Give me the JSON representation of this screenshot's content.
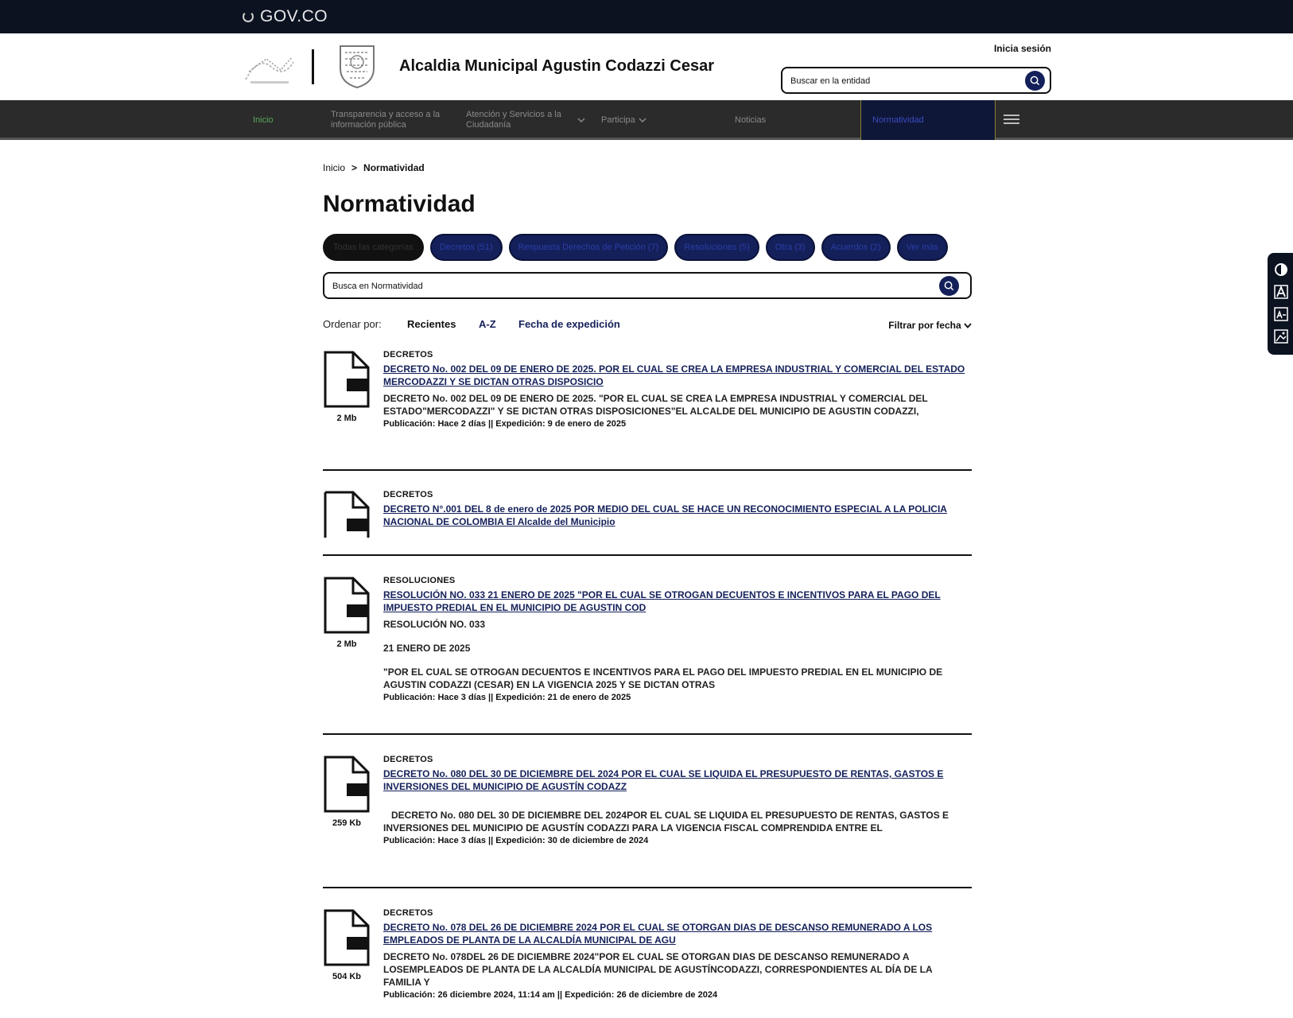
{
  "govbar": {
    "logo_text": "GOV.CO"
  },
  "header": {
    "site_title": "Alcaldia Municipal Agustin Codazzi Cesar",
    "login_label": "Inicia sesión",
    "search_placeholder": "Buscar en la entidad"
  },
  "nav": {
    "items": [
      {
        "label": "Inicio"
      },
      {
        "label": "Transparencia y acceso a la información pública"
      },
      {
        "label": "Atención y Servicios a la Ciudadanía"
      },
      {
        "label": "Participa"
      },
      {
        "label": "Noticias"
      },
      {
        "label": "Normatividad"
      }
    ]
  },
  "breadcrumb": {
    "home": "Inicio",
    "separator": ">",
    "current": "Normatividad"
  },
  "page": {
    "title": "Normatividad"
  },
  "chips": [
    {
      "label": "Todas las categorías"
    },
    {
      "label": "Decretos (51)"
    },
    {
      "label": "Respuesta Derechos de Petición (7)"
    },
    {
      "label": "Resoluciones (5)"
    },
    {
      "label": "Otra (3)"
    },
    {
      "label": "Acuerdos (2)"
    },
    {
      "label": "Ver más"
    }
  ],
  "norm_search": {
    "placeholder": "Busca en Normatividad"
  },
  "sort": {
    "label": "Ordenar por:",
    "recent": "Recientes",
    "az": "A-Z",
    "date": "Fecha de expedición",
    "filter": "Filtrar por fecha"
  },
  "results": [
    {
      "category": "DECRETOS",
      "title": "DECRETO No. 002 DEL 09 DE ENERO DE 2025. POR EL CUAL SE CREA LA EMPRESA INDUSTRIAL Y COMERCIAL DEL ESTADO MERCODAZZI Y SE DICTAN OTRAS DISPOSICIO",
      "description": [
        "DECRETO No. 002 DEL 09 DE ENERO DE 2025. \"POR EL CUAL SE CREA LA EMPRESA INDUSTRIAL Y COMERCIAL DEL ESTADO\"MERCODAZZI\" Y SE DICTAN OTRAS DISPOSICIONES\"EL ALCALDE DEL MUNICIPIO DE AGUSTIN CODAZZI,"
      ],
      "meta": "Publicación: Hace 2 días || Expedición: 9 de enero de 2025",
      "size": "2 Mb"
    },
    {
      "category": "DECRETOS",
      "title": "DECRETO N°.001 DEL 8 de enero de 2025 POR MEDIO DEL CUAL SE HACE UN RECONOCIMIENTO ESPECIAL A LA POLICIA NACIONAL DE COLOMBIA El Alcalde del Municipio",
      "description": [],
      "meta": "",
      "size": ""
    },
    {
      "category": "RESOLUCIONES",
      "title": "RESOLUCIÓN NO. 033 21 ENERO DE 2025 \"POR EL CUAL SE OTROGAN DECUENTOS E INCENTIVOS PARA EL PAGO DEL IMPUESTO PREDIAL EN EL MUNICIPIO DE AGUSTIN COD",
      "description": [
        "RESOLUCIÓN NO. 033",
        "21 ENERO DE 2025",
        "\"POR EL CUAL SE OTROGAN DECUENTOS E INCENTIVOS PARA EL PAGO DEL IMPUESTO PREDIAL EN EL MUNICIPIO DE AGUSTIN CODAZZI (CESAR) EN LA VIGENCIA 2025 Y SE DICTAN OTRAS"
      ],
      "meta": "Publicación: Hace 3 días || Expedición: 21 de enero de 2025",
      "size": "2 Mb"
    },
    {
      "category": "DECRETOS",
      "title": "DECRETO No. 080 DEL 30 DE DICIEMBRE DEL 2024 POR EL CUAL SE LIQUIDA EL PRESUPUESTO DE RENTAS, GASTOS E INVERSIONES DEL MUNICIPIO DE AGUSTÍN CODAZZ",
      "description": [
        "",
        "DECRETO No. 080 DEL 30 DE DICIEMBRE DEL 2024POR EL CUAL SE LIQUIDA EL PRESUPUESTO DE RENTAS, GASTOS E INVERSIONES DEL MUNICIPIO DE AGUSTÍN CODAZZI PARA LA VIGENCIA FISCAL COMPRENDIDA ENTRE EL"
      ],
      "meta": "Publicación: Hace 3 días || Expedición: 30 de diciembre de 2024",
      "size": "259 Kb"
    },
    {
      "category": "DECRETOS",
      "title": "DECRETO No. 078 DEL 26 DE DICIEMBRE 2024 POR EL CUAL SE OTORGAN DIAS DE DESCANSO REMUNERADO A LOS EMPLEADOS DE PLANTA DE LA ALCALDÍA MUNICIPAL DE AGU",
      "description": [
        "DECRETO No. 078DEL 26 DE DICIEMBRE 2024\"POR EL CUAL SE OTORGAN DIAS DE DESCANSO REMUNERADO A LOSEMPLEADOS DE PLANTA DE LA ALCALDÍA MUNICIPAL DE AGUSTÍNCODAZZI, CORRESPONDIENTES AL DÍA DE LA FAMILIA Y"
      ],
      "meta": "Publicación: 26 diciembre 2024, 11:14 am || Expedición: 26 de diciembre de 2024",
      "size": "504 Kb"
    }
  ],
  "icons": {
    "doc": "pdf-file-icon",
    "search": "search-icon",
    "chevron": "chevron-down-icon",
    "menu": "hamburger-icon"
  },
  "colors": {
    "navy": "#14205a",
    "govbar": "#0b1220",
    "nav_bg": "#2b2b2b"
  }
}
